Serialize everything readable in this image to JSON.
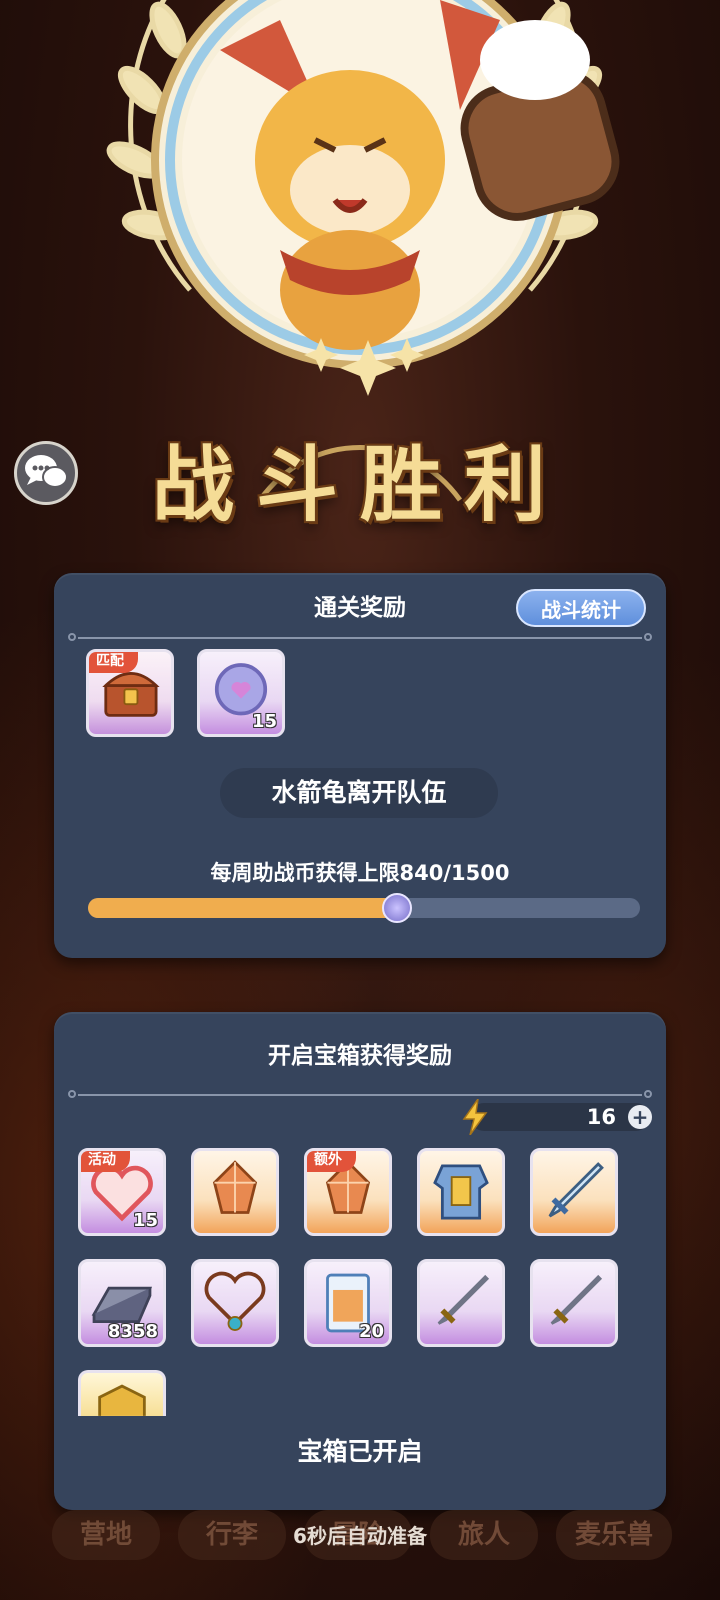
{
  "victory": {
    "title": "战斗胜利"
  },
  "chat": {
    "icon": "chat-bubbles-icon"
  },
  "clear_rewards": {
    "title": "通关奖励",
    "stats_button": "战斗统计",
    "items": [
      {
        "icon": "treasure-chest-icon",
        "tag": "匹配",
        "count": ""
      },
      {
        "icon": "purple-coin-icon",
        "tag": "",
        "count": "15"
      }
    ],
    "notice": "水箭龟离开队伍",
    "weekly_limit_text": "每周助战币获得上限840/1500",
    "weekly_progress": {
      "current": 840,
      "max": 1500
    }
  },
  "chest_rewards": {
    "title": "开启宝箱获得奖励",
    "energy": {
      "icon": "lightning-icon",
      "value": "16",
      "plus": "+"
    },
    "items": [
      {
        "icon": "heart-icon",
        "tag": "活动",
        "count": "15",
        "rarity": "purple"
      },
      {
        "icon": "orange-crystal-icon",
        "tag": "",
        "count": "",
        "rarity": "orange"
      },
      {
        "icon": "orange-crystal-icon",
        "tag": "额外",
        "count": "",
        "rarity": "orange"
      },
      {
        "icon": "armor-icon",
        "tag": "",
        "count": "",
        "rarity": "orange"
      },
      {
        "icon": "crystal-sword-icon",
        "tag": "",
        "count": "",
        "rarity": "orange"
      },
      {
        "icon": "iron-ingot-icon",
        "tag": "",
        "count": "8358",
        "rarity": "purple"
      },
      {
        "icon": "necklace-icon",
        "tag": "",
        "count": "",
        "rarity": "purple"
      },
      {
        "icon": "ticket-icon",
        "tag": "",
        "count": "20",
        "rarity": "purple"
      },
      {
        "icon": "sword-icon",
        "tag": "",
        "count": "",
        "rarity": "purple"
      },
      {
        "icon": "sword-icon",
        "tag": "",
        "count": "",
        "rarity": "purple"
      },
      {
        "icon": "gold-coin-icon",
        "tag": "",
        "count": "",
        "rarity": "gold"
      }
    ],
    "status": "宝箱已开启"
  },
  "auto_ready": "6秒后自动准备",
  "bottom_nav": {
    "tabs": [
      "营地",
      "行李",
      "冒险",
      "旅人",
      "麦乐兽"
    ]
  },
  "colors": {
    "panel": "#36445c",
    "accent_blue": "#6f9be3",
    "progress_fill": "#f0ad4e",
    "tag_red": "#e2533a",
    "title_gold": "#f5dc96"
  }
}
